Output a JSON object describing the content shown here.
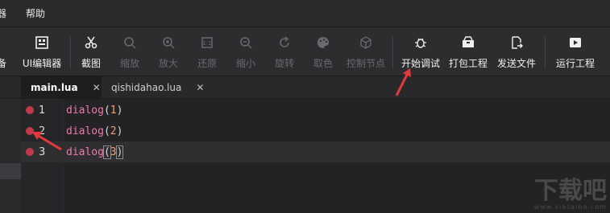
{
  "menu": {
    "cut_item": "器",
    "help": "帮助"
  },
  "toolbar": {
    "partial_left": "备",
    "ui_editor": "UI编辑器",
    "screenshot": "截图",
    "zoom": "缩放",
    "zoom_in": "放大",
    "restore": "还原",
    "zoom_out": "缩小",
    "rotate": "旋转",
    "pick_color": "取色",
    "control_node": "控制节点",
    "start_debug": "开始调试",
    "pack_project": "打包工程",
    "send_file": "发送文件",
    "run_project": "运行工程"
  },
  "tabs": [
    {
      "label": "main.lua",
      "close": "✕"
    },
    {
      "label": "qishidahao.lua",
      "close": "✕"
    }
  ],
  "lines": [
    {
      "number": "1",
      "func": "dialog",
      "arg": "1"
    },
    {
      "number": "2",
      "func": "dialog",
      "arg": "2"
    },
    {
      "number": "3",
      "func": "dialog",
      "arg": "3"
    }
  ],
  "watermark": {
    "text": "下载吧",
    "url": "www.xiazaiba.com"
  },
  "colors": {
    "breakpoint": "#c0394b",
    "arrow": "#e23a3a",
    "keyword": "#f078ad",
    "number": "#f2a16a"
  }
}
